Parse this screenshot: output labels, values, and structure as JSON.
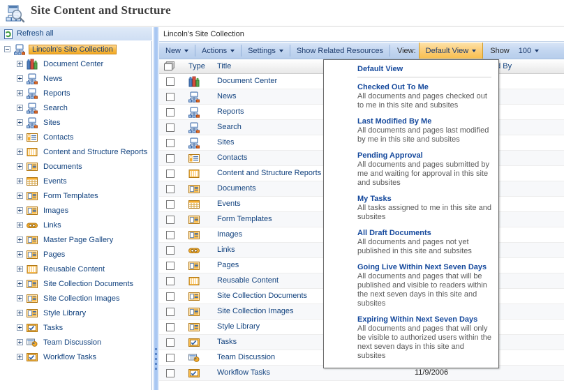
{
  "header": {
    "title": "Site Content and Structure",
    "icon": "site-structure-search-icon"
  },
  "left_pane": {
    "refresh": {
      "label": "Refresh all",
      "icon": "refresh-icon"
    },
    "tree": [
      {
        "label": "Lincoln's Site Collection",
        "icon": "site-collection-icon",
        "level": 0,
        "expander": "minus",
        "selected": true
      },
      {
        "label": "Document Center",
        "icon": "document-center-icon",
        "level": 1,
        "expander": "plus",
        "selected": false
      },
      {
        "label": "News",
        "icon": "site-icon",
        "level": 1,
        "expander": "plus",
        "selected": false
      },
      {
        "label": "Reports",
        "icon": "site-icon",
        "level": 1,
        "expander": "plus",
        "selected": false
      },
      {
        "label": "Search",
        "icon": "site-icon",
        "level": 1,
        "expander": "plus",
        "selected": false
      },
      {
        "label": "Sites",
        "icon": "site-icon",
        "level": 1,
        "expander": "plus",
        "selected": false
      },
      {
        "label": "Contacts",
        "icon": "contacts-list-icon",
        "level": 1,
        "expander": "plus",
        "selected": false
      },
      {
        "label": "Content and Structure Reports",
        "icon": "reports-list-icon",
        "level": 1,
        "expander": "plus",
        "selected": false
      },
      {
        "label": "Documents",
        "icon": "document-library-icon",
        "level": 1,
        "expander": "plus",
        "selected": false
      },
      {
        "label": "Events",
        "icon": "calendar-icon",
        "level": 1,
        "expander": "plus",
        "selected": false
      },
      {
        "label": "Form Templates",
        "icon": "document-library-icon",
        "level": 1,
        "expander": "plus",
        "selected": false
      },
      {
        "label": "Images",
        "icon": "document-library-icon",
        "level": 1,
        "expander": "plus",
        "selected": false
      },
      {
        "label": "Links",
        "icon": "links-list-icon",
        "level": 1,
        "expander": "plus",
        "selected": false
      },
      {
        "label": "Master Page Gallery",
        "icon": "document-library-icon",
        "level": 1,
        "expander": "plus",
        "selected": false
      },
      {
        "label": "Pages",
        "icon": "document-library-icon",
        "level": 1,
        "expander": "plus",
        "selected": false
      },
      {
        "label": "Reusable Content",
        "icon": "reports-list-icon",
        "level": 1,
        "expander": "plus",
        "selected": false
      },
      {
        "label": "Site Collection Documents",
        "icon": "document-library-icon",
        "level": 1,
        "expander": "plus",
        "selected": false
      },
      {
        "label": "Site Collection Images",
        "icon": "document-library-icon",
        "level": 1,
        "expander": "plus",
        "selected": false
      },
      {
        "label": "Style Library",
        "icon": "document-library-icon",
        "level": 1,
        "expander": "plus",
        "selected": false
      },
      {
        "label": "Tasks",
        "icon": "tasks-list-icon",
        "level": 1,
        "expander": "plus",
        "selected": false
      },
      {
        "label": "Team Discussion",
        "icon": "discussion-board-icon",
        "level": 1,
        "expander": "plus",
        "selected": false
      },
      {
        "label": "Workflow Tasks",
        "icon": "tasks-list-icon",
        "level": 1,
        "expander": "plus",
        "selected": false
      }
    ]
  },
  "right_pane": {
    "breadcrumb": "Lincoln's Site Collection",
    "toolbar": {
      "new_label": "New",
      "actions_label": "Actions",
      "settings_label": "Settings",
      "show_related_label": "Show Related Resources",
      "view_label": "View:",
      "view_value": "Default View",
      "show_label": "Show",
      "show_value": "100"
    },
    "columns": {
      "type": "Type",
      "title": "Title",
      "modified_by": "ed By"
    },
    "rows": [
      {
        "title": "Document Center",
        "icon": "document-center-icon",
        "date": ""
      },
      {
        "title": "News",
        "icon": "site-icon",
        "date": ""
      },
      {
        "title": "Reports",
        "icon": "site-icon",
        "date": ""
      },
      {
        "title": "Search",
        "icon": "site-icon",
        "date": ""
      },
      {
        "title": "Sites",
        "icon": "site-icon",
        "date": ""
      },
      {
        "title": "Contacts",
        "icon": "contacts-list-icon",
        "date": ""
      },
      {
        "title": "Content and Structure Reports",
        "icon": "reports-list-icon",
        "date": ""
      },
      {
        "title": "Documents",
        "icon": "document-library-icon",
        "date": ""
      },
      {
        "title": "Events",
        "icon": "calendar-icon",
        "date": ""
      },
      {
        "title": "Form Templates",
        "icon": "document-library-icon",
        "date": ""
      },
      {
        "title": "Images",
        "icon": "document-library-icon",
        "date": ""
      },
      {
        "title": "Links",
        "icon": "links-list-icon",
        "date": ""
      },
      {
        "title": "Pages",
        "icon": "document-library-icon",
        "date": ""
      },
      {
        "title": "Reusable Content",
        "icon": "reports-list-icon",
        "date": ""
      },
      {
        "title": "Site Collection Documents",
        "icon": "document-library-icon",
        "date": ""
      },
      {
        "title": "Site Collection Images",
        "icon": "document-library-icon",
        "date": ""
      },
      {
        "title": "Style Library",
        "icon": "document-library-icon",
        "date": ""
      },
      {
        "title": "Tasks",
        "icon": "tasks-list-icon",
        "date": ""
      },
      {
        "title": "Team Discussion",
        "icon": "discussion-board-icon",
        "date": ""
      },
      {
        "title": "Workflow Tasks",
        "icon": "tasks-list-icon",
        "date": "11/9/2006"
      }
    ]
  },
  "view_menu": {
    "items": [
      {
        "title": "Default View",
        "desc": ""
      },
      {
        "title": "Checked Out To Me",
        "desc": "All documents and pages checked out to me in this site and subsites"
      },
      {
        "title": "Last Modified By Me",
        "desc": "All documents and pages last modified by me in this site and subsites"
      },
      {
        "title": "Pending Approval",
        "desc": "All documents and pages submitted by me and waiting for approval in this site and subsites"
      },
      {
        "title": "My Tasks",
        "desc": "All tasks assigned to me in this site and subsites"
      },
      {
        "title": "All Draft Documents",
        "desc": "All documents and pages not yet published in this site and subsites"
      },
      {
        "title": "Going Live Within Next Seven Days",
        "desc": "All documents and pages that will be published and visible to readers within the next seven days in this site and subsites"
      },
      {
        "title": "Expiring Within Next Seven Days",
        "desc": "All documents and pages that will only be visible to authorized users within the next seven days in this site and subsites"
      }
    ]
  },
  "colors": {
    "accent_blue": "#13437f",
    "toolbar_blue": "#c3d6f0",
    "selected_gold": "#f7b93f",
    "menu_link": "#14489c"
  }
}
